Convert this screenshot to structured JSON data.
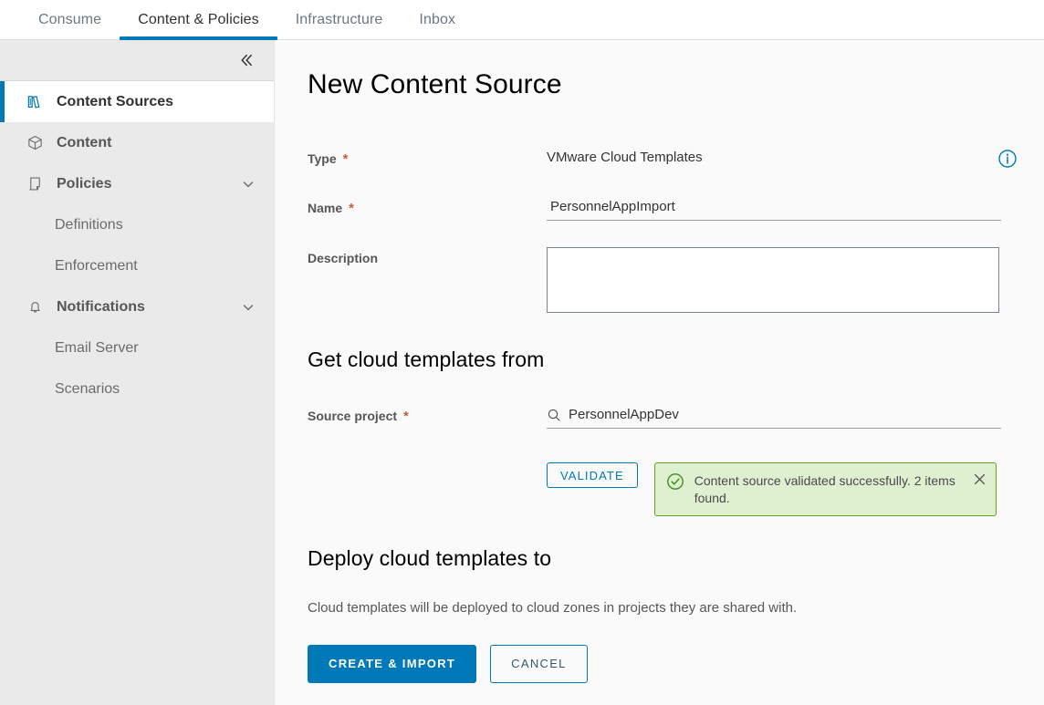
{
  "topbar": {
    "tabs": [
      {
        "label": "Consume",
        "active": false
      },
      {
        "label": "Content & Policies",
        "active": true
      },
      {
        "label": "Infrastructure",
        "active": false
      },
      {
        "label": "Inbox",
        "active": false
      }
    ]
  },
  "sidebar": {
    "collapse_icon": "double-chevron-left-icon",
    "items": [
      {
        "label": "Content Sources",
        "icon": "books-icon",
        "active": true,
        "expandable": false,
        "sub": false
      },
      {
        "label": "Content",
        "icon": "box-icon",
        "active": false,
        "expandable": false,
        "sub": false
      },
      {
        "label": "Policies",
        "icon": "scroll-icon",
        "active": false,
        "expandable": true,
        "sub": false
      },
      {
        "label": "Definitions",
        "icon": "",
        "active": false,
        "expandable": false,
        "sub": true
      },
      {
        "label": "Enforcement",
        "icon": "",
        "active": false,
        "expandable": false,
        "sub": true
      },
      {
        "label": "Notifications",
        "icon": "bell-icon",
        "active": false,
        "expandable": true,
        "sub": false
      },
      {
        "label": "Email Server",
        "icon": "",
        "active": false,
        "expandable": false,
        "sub": true
      },
      {
        "label": "Scenarios",
        "icon": "",
        "active": false,
        "expandable": false,
        "sub": true
      }
    ]
  },
  "main": {
    "page_title": "New Content Source",
    "type_label": "Type",
    "type_required": "*",
    "type_value": "VMware Cloud Templates",
    "info_icon": "info-circle-icon",
    "name_label": "Name",
    "name_required": "*",
    "name_value": "PersonnelAppImport",
    "name_placeholder": "",
    "description_label": "Description",
    "description_value": "",
    "description_placeholder": "",
    "get_templates_heading": "Get cloud templates from",
    "source_project_label": "Source project",
    "source_project_required": "*",
    "source_project_value": "PersonnelAppDev",
    "source_project_placeholder": "",
    "search_icon": "search-icon",
    "validate_label": "VALIDATE",
    "alert": {
      "icon": "check-circle-icon",
      "message": "Content source validated successfully. 2 items found.",
      "close_icon": "close-icon"
    },
    "deploy_heading": "Deploy cloud templates to",
    "deploy_helper": "Cloud templates will be deployed to cloud zones in projects they are shared with.",
    "create_import_label": "CREATE & IMPORT",
    "cancel_label": "CANCEL"
  },
  "colors": {
    "accent": "#0079b8",
    "success_bg": "#dff0d0",
    "success_border": "#62a420",
    "required": "#c25f3e",
    "sidebar_bg": "#eaeaea"
  }
}
